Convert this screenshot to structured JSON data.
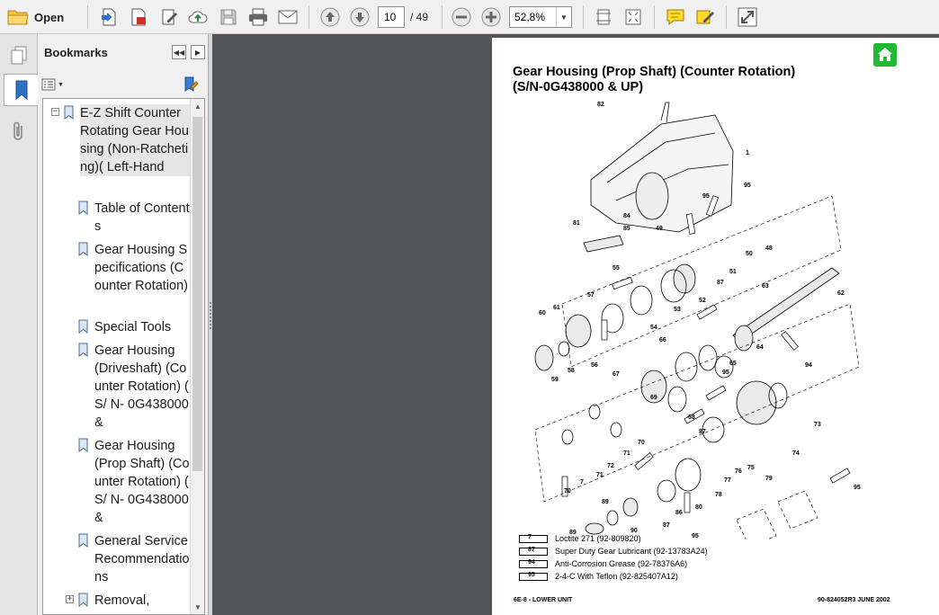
{
  "toolbar": {
    "open_label": "Open",
    "page_current": "10",
    "page_total": "/ 49",
    "zoom": "52,8%"
  },
  "bookmarks": {
    "title": "Bookmarks",
    "items": [
      {
        "label": "E-Z Shift Counter Rotating Gear Housing (Non-Ratcheting)( Left-Hand",
        "expander": "−"
      },
      {
        "label": "Table of Contents"
      },
      {
        "label": "Gear Housing Specifications (Counter Rotation)"
      },
      {
        "label": "Special Tools"
      },
      {
        "label": "Gear Housing (Driveshaft) (Counter Rotation) ( S/ N- 0G438000 &"
      },
      {
        "label": "Gear Housing (Prop Shaft) (Counter Rotation) ( S/ N- 0G438000 &"
      },
      {
        "label": "General Service Recommendations"
      },
      {
        "label": "Removal,",
        "expander": "+"
      }
    ]
  },
  "document": {
    "title_line1": "Gear Housing (Prop Shaft) (Counter Rotation)",
    "title_line2": "(S/N-0G438000 & UP)",
    "part_numbers": [
      "82",
      "1",
      "95",
      "81",
      "84",
      "85",
      "49",
      "95",
      "48",
      "50",
      "51",
      "55",
      "52",
      "87",
      "53",
      "57",
      "54",
      "61",
      "60",
      "63",
      "62",
      "56",
      "58",
      "59",
      "64",
      "66",
      "65",
      "94",
      "67",
      "95",
      "73",
      "69",
      "68",
      "87",
      "70",
      "71",
      "72",
      "74",
      "75",
      "79",
      "71",
      "7",
      "70",
      "76",
      "77",
      "78",
      "95",
      "86",
      "89",
      "87",
      "80",
      "90",
      "89",
      "95"
    ],
    "legend": [
      {
        "tube": "7",
        "text": "Loctite 271 (92-809820)"
      },
      {
        "tube": "87",
        "text": "Super Duty Gear Lubricant (92-13783A24)"
      },
      {
        "tube": "94",
        "text": "Anti-Corrosion Grease (92-78376A6)"
      },
      {
        "tube": "95",
        "text": "2-4-C With Teflon (92-825407A12)"
      }
    ],
    "footer_left": "6E-8 - LOWER UNIT",
    "footer_right": "90-824052R3   JUNE 2002"
  }
}
